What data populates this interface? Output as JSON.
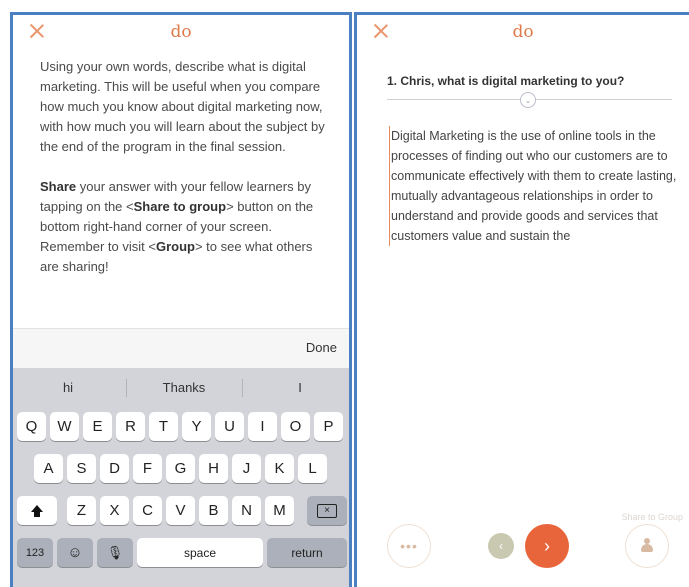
{
  "app": {
    "logo": "do"
  },
  "left": {
    "instructions": {
      "para1": "Using your own words, describe what is digital marketing. This will be useful when you compare how much you know about digital marketing now, with how much you will learn about the subject by the end of the program in the final session.",
      "share_word": "Share",
      "para2_a": " your answer with your fellow learners by tapping on the <",
      "share_to_group": "Share to group",
      "para2_b": "> button on the bottom right-hand corner of your screen. Remember to visit <",
      "group": "Group",
      "para2_c": "> to see what others are sharing!"
    },
    "done_label": "Done",
    "keyboard": {
      "suggestions": [
        "hi",
        "Thanks",
        "I"
      ],
      "row1": [
        "Q",
        "W",
        "E",
        "R",
        "T",
        "Y",
        "U",
        "I",
        "O",
        "P"
      ],
      "row2": [
        "A",
        "S",
        "D",
        "F",
        "G",
        "H",
        "J",
        "K",
        "L"
      ],
      "row3": [
        "Z",
        "X",
        "C",
        "V",
        "B",
        "N",
        "M"
      ],
      "numbers_key": "123",
      "emoji_key": "☺",
      "mic_key": "🎙",
      "space_key": "space",
      "return_key": "return"
    }
  },
  "right": {
    "question": "1. Chris, what is digital marketing to you?",
    "answer": "Digital Marketing is the use of online tools in the processes of finding out who our customers are to communicate effectively with them to create lasting, mutually advantageous relationships in order to understand and provide goods and services that customers value and sustain the",
    "share_label": "Share to Group",
    "more_glyph": "•••",
    "prev_glyph": "‹",
    "next_glyph": "›",
    "chevron_glyph": "⌄"
  },
  "colors": {
    "accent": "#e8643a",
    "frame": "#4a7fc1",
    "keyboard_bg": "#d2d4da"
  }
}
